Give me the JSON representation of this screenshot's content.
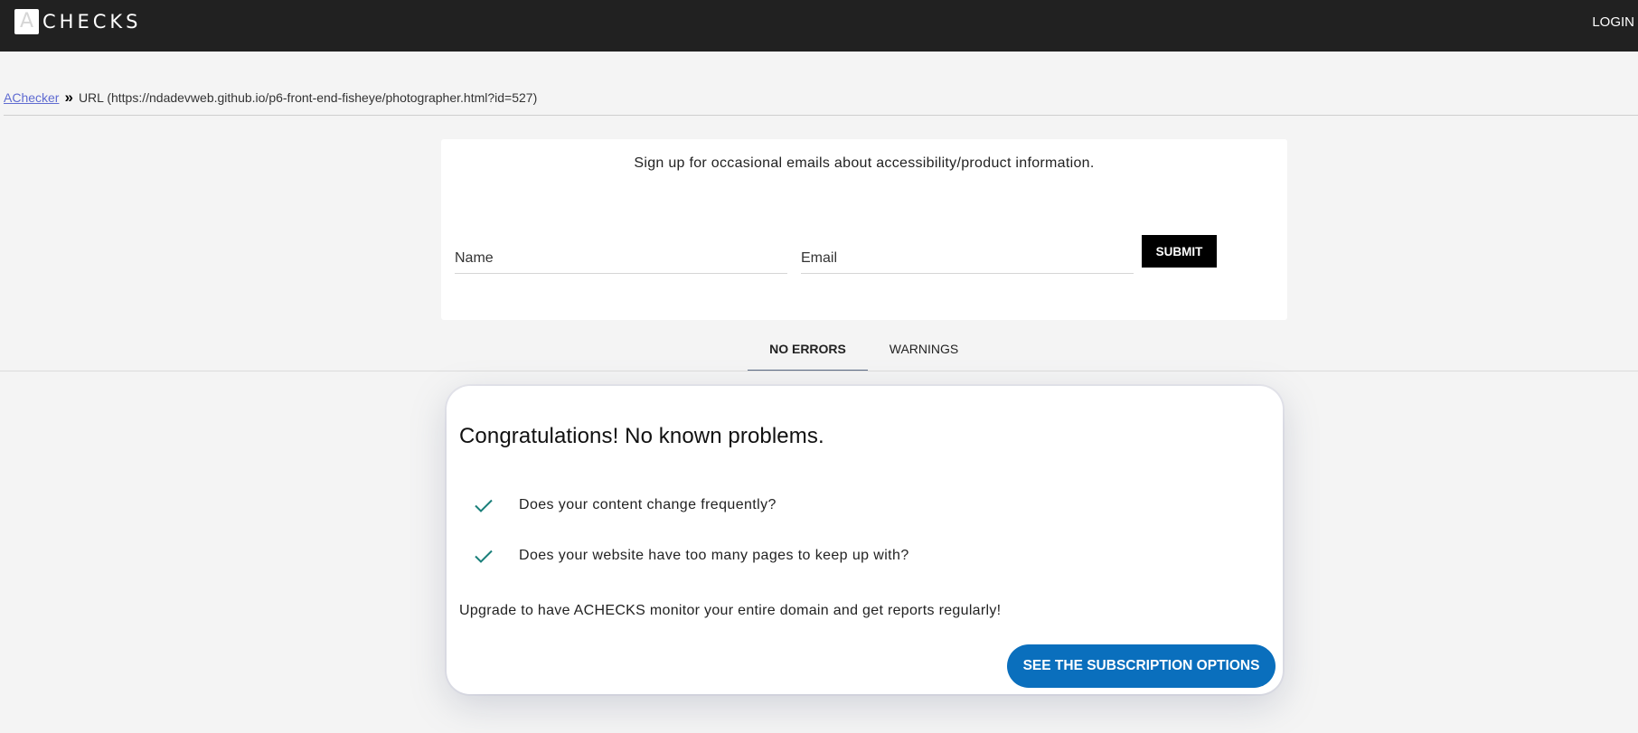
{
  "header": {
    "logo_letter": "A",
    "logo_text": "CHECKS",
    "login_label": "LOGIN"
  },
  "breadcrumb": {
    "root": "AChecker",
    "separator": "»",
    "current": "URL (https://ndadevweb.github.io/p6-front-end-fisheye/photographer.html?id=527)"
  },
  "signup": {
    "text": "Sign up for occasional emails about accessibility/product information.",
    "name_placeholder": "Name",
    "email_placeholder": "Email",
    "submit_label": "SUBMIT"
  },
  "tabs": [
    {
      "label": "NO ERRORS",
      "active": true
    },
    {
      "label": "WARNINGS",
      "active": false
    }
  ],
  "result": {
    "title": "Congratulations! No known problems.",
    "items": [
      {
        "icon": "check-icon",
        "label": "Does your content change frequently?"
      },
      {
        "icon": "check-icon",
        "label": "Does your website have too many pages to keep up with?"
      }
    ],
    "upgrade_text": "Upgrade to have ACHECKS monitor your entire domain and get reports regularly!",
    "cta_label": "SEE THE SUBSCRIPTION OPTIONS"
  },
  "colors": {
    "topbar": "#212121",
    "check": "#1a7f7a",
    "cta": "#0a6fbd",
    "link": "#5f6bd1"
  }
}
